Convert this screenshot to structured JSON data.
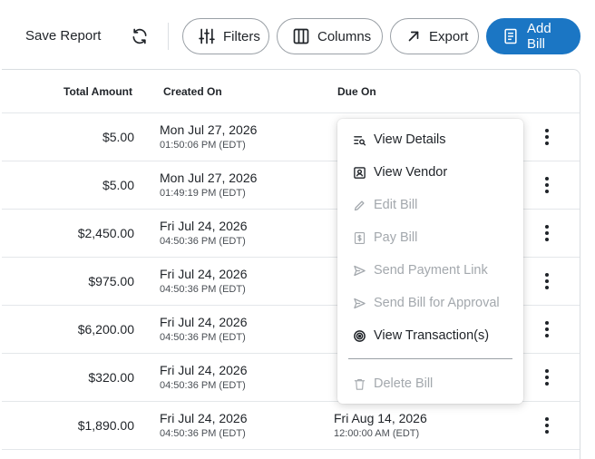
{
  "toolbar": {
    "save_report": "Save Report",
    "filters": "Filters",
    "columns": "Columns",
    "export": "Export",
    "add_bill": "Add Bill",
    "accent": "#1b76c4"
  },
  "table": {
    "headers": {
      "amount": "Total Amount",
      "created": "Created On",
      "due": "Due On"
    },
    "rows": [
      {
        "amount": "$5.00",
        "created_date": "Mon Jul 27, 2026",
        "created_time": "01:50:06 PM (EDT)",
        "due_date": "",
        "due_time": ""
      },
      {
        "amount": "$5.00",
        "created_date": "Mon Jul 27, 2026",
        "created_time": "01:49:19 PM (EDT)",
        "due_date": "",
        "due_time": ""
      },
      {
        "amount": "$2,450.00",
        "created_date": "Fri Jul 24, 2026",
        "created_time": "04:50:36 PM (EDT)",
        "due_date": "",
        "due_time": ""
      },
      {
        "amount": "$975.00",
        "created_date": "Fri Jul 24, 2026",
        "created_time": "04:50:36 PM (EDT)",
        "due_date": "",
        "due_time": ""
      },
      {
        "amount": "$6,200.00",
        "created_date": "Fri Jul 24, 2026",
        "created_time": "04:50:36 PM (EDT)",
        "due_date": "",
        "due_time": ""
      },
      {
        "amount": "$320.00",
        "created_date": "Fri Jul 24, 2026",
        "created_time": "04:50:36 PM (EDT)",
        "due_date": "",
        "due_time": ""
      },
      {
        "amount": "$1,890.00",
        "created_date": "Fri Jul 24, 2026",
        "created_time": "04:50:36 PM (EDT)",
        "due_date": "Fri Aug 14, 2026",
        "due_time": "12:00:00 AM (EDT)"
      }
    ]
  },
  "menu": {
    "items": [
      {
        "label": "View Details",
        "icon": "view-details-icon",
        "enabled": true
      },
      {
        "label": "View Vendor",
        "icon": "vendor-icon",
        "enabled": true
      },
      {
        "label": "Edit Bill",
        "icon": "pencil-icon",
        "enabled": false
      },
      {
        "label": "Pay Bill",
        "icon": "dollar-icon",
        "enabled": false
      },
      {
        "label": "Send Payment Link",
        "icon": "send-icon",
        "enabled": false
      },
      {
        "label": "Send Bill for Approval",
        "icon": "send-icon",
        "enabled": false
      },
      {
        "label": "View Transaction(s)",
        "icon": "target-icon",
        "enabled": true
      },
      {
        "label": "Delete Bill",
        "icon": "trash-icon",
        "enabled": false
      }
    ]
  }
}
